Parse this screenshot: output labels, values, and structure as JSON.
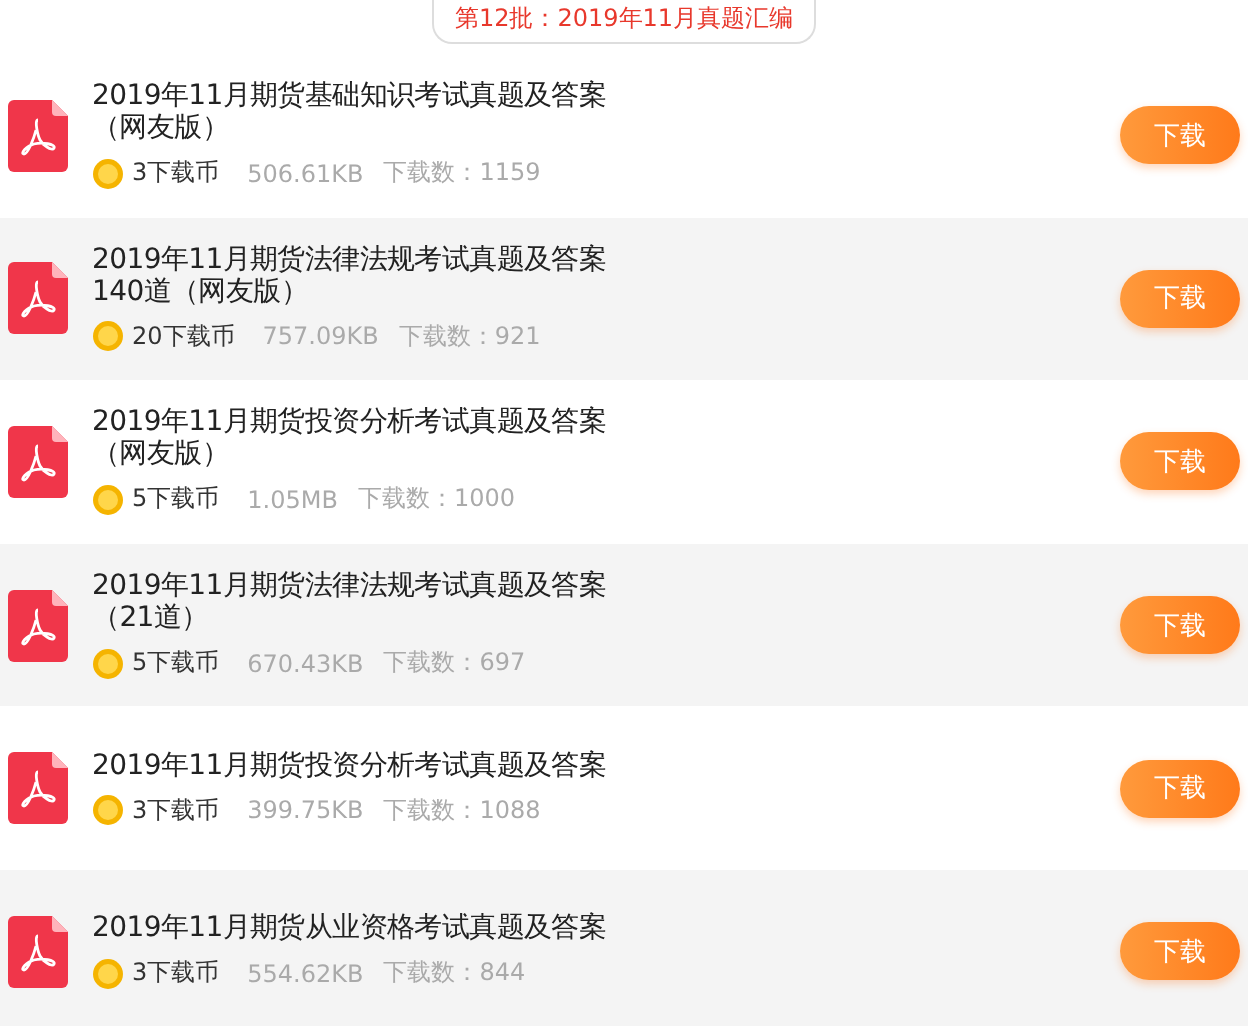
{
  "batch_title": "第12批：2019年11月真题汇编",
  "files": [
    {
      "title": "2019年11月期货基础知识考试真题及答案（网友版）",
      "coins": "3下载币",
      "size": "506.61KB",
      "downloads": "下载数：1159",
      "button": "下载"
    },
    {
      "title": "2019年11月期货法律法规考试真题及答案140道（网友版）",
      "coins": "20下载币",
      "size": "757.09KB",
      "downloads": "下载数：921",
      "button": "下载"
    },
    {
      "title": "2019年11月期货投资分析考试真题及答案（网友版）",
      "coins": "5下载币",
      "size": "1.05MB",
      "downloads": "下载数：1000",
      "button": "下载"
    },
    {
      "title": "2019年11月期货法律法规考试真题及答案（21道）",
      "coins": "5下载币",
      "size": "670.43KB",
      "downloads": "下载数：697",
      "button": "下载"
    },
    {
      "title": "2019年11月期货投资分析考试真题及答案",
      "coins": "3下载币",
      "size": "399.75KB",
      "downloads": "下载数：1088",
      "button": "下载"
    },
    {
      "title": "2019年11月期货从业资格考试真题及答案",
      "coins": "3下载币",
      "size": "554.62KB",
      "downloads": "下载数：844",
      "button": "下载"
    }
  ]
}
